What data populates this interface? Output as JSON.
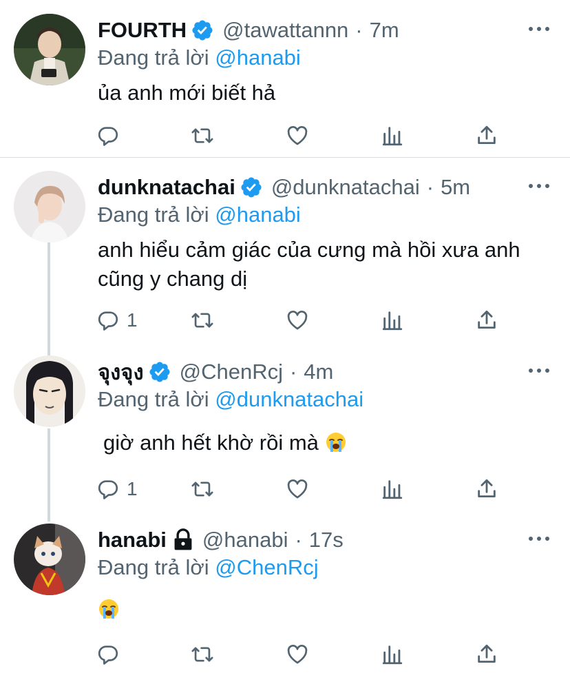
{
  "colors": {
    "accent": "#1d9bf0",
    "muted": "#536471",
    "text": "#0f1419",
    "divider": "#d9dde1"
  },
  "icons": {
    "verified": "verified-badge-icon",
    "locked": "lock-icon",
    "reply": "reply-icon",
    "retweet": "retweet-icon",
    "like": "heart-icon",
    "analytics": "analytics-icon",
    "share": "share-icon",
    "more": "more-icon",
    "crying_emoji": "loudly-crying-face-emoji"
  },
  "tweets": [
    {
      "name": "FOURTH",
      "handle": "@tawattannn",
      "dot": "·",
      "time": "7m",
      "replying_prefix": "Đang trả lời",
      "replying_to": "@hanabi",
      "text": "ủa anh mới biết hả",
      "reply_count": "",
      "verified": true
    },
    {
      "name": "dunknatachai",
      "handle": "@dunknatachai",
      "dot": "·",
      "time": "5m",
      "replying_prefix": "Đang trả lời",
      "replying_to": "@hanabi",
      "text": "anh hiểu cảm giác của cưng mà hồi xưa anh cũng y chang dị",
      "reply_count": "1",
      "verified": true
    },
    {
      "name": "จุงจุง",
      "handle": "@ChenRcj",
      "dot": "·",
      "time": "4m",
      "replying_prefix": "Đang trả lời",
      "replying_to": "@dunknatachai",
      "text": "giờ anh hết khờ rồi mà",
      "reply_count": "1",
      "verified": true
    },
    {
      "name": "hanabi",
      "handle": "@hanabi",
      "dot": "·",
      "time": "17s",
      "replying_prefix": "Đang trả lời",
      "replying_to": "@ChenRcj",
      "text": "",
      "reply_count": "",
      "verified": false,
      "locked": true
    }
  ]
}
